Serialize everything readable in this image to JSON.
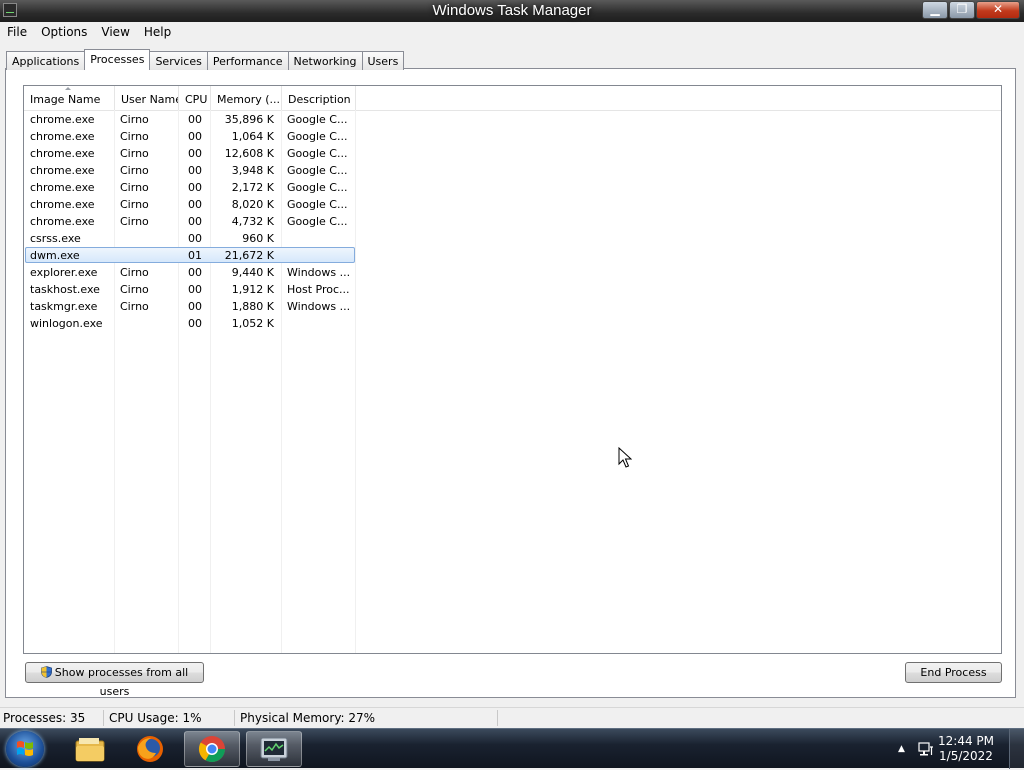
{
  "window": {
    "title": "Windows Task Manager",
    "minimize_glyph": "▁",
    "maximize_glyph": "❐",
    "close_glyph": "✕"
  },
  "menu": [
    "File",
    "Options",
    "View",
    "Help"
  ],
  "tabs": [
    "Applications",
    "Processes",
    "Services",
    "Performance",
    "Networking",
    "Users"
  ],
  "active_tab": "Processes",
  "columns": {
    "image_name": "Image Name",
    "user_name": "User Name",
    "cpu": "CPU",
    "memory": "Memory (...",
    "description": "Description"
  },
  "processes": [
    {
      "name": "chrome.exe",
      "user": "Cirno",
      "cpu": "00",
      "memory": "35,896 K",
      "description": "Google C..."
    },
    {
      "name": "chrome.exe",
      "user": "Cirno",
      "cpu": "00",
      "memory": "1,064 K",
      "description": "Google C..."
    },
    {
      "name": "chrome.exe",
      "user": "Cirno",
      "cpu": "00",
      "memory": "12,608 K",
      "description": "Google C..."
    },
    {
      "name": "chrome.exe",
      "user": "Cirno",
      "cpu": "00",
      "memory": "3,948 K",
      "description": "Google C..."
    },
    {
      "name": "chrome.exe",
      "user": "Cirno",
      "cpu": "00",
      "memory": "2,172 K",
      "description": "Google C..."
    },
    {
      "name": "chrome.exe",
      "user": "Cirno",
      "cpu": "00",
      "memory": "8,020 K",
      "description": "Google C..."
    },
    {
      "name": "chrome.exe",
      "user": "Cirno",
      "cpu": "00",
      "memory": "4,732 K",
      "description": "Google C..."
    },
    {
      "name": "csrss.exe",
      "user": "",
      "cpu": "00",
      "memory": "960 K",
      "description": ""
    },
    {
      "name": "dwm.exe",
      "user": "",
      "cpu": "01",
      "memory": "21,672 K",
      "description": "",
      "selected": true
    },
    {
      "name": "explorer.exe",
      "user": "Cirno",
      "cpu": "00",
      "memory": "9,440 K",
      "description": "Windows ..."
    },
    {
      "name": "taskhost.exe",
      "user": "Cirno",
      "cpu": "00",
      "memory": "1,912 K",
      "description": "Host Proc..."
    },
    {
      "name": "taskmgr.exe",
      "user": "Cirno",
      "cpu": "00",
      "memory": "1,880 K",
      "description": "Windows ..."
    },
    {
      "name": "winlogon.exe",
      "user": "",
      "cpu": "00",
      "memory": "1,052 K",
      "description": ""
    }
  ],
  "buttons": {
    "show_all": "Show processes from all users",
    "end_process": "End Process"
  },
  "status": {
    "processes": "Processes: 35",
    "cpu_usage": "CPU Usage: 1%",
    "physical_memory": "Physical Memory: 27%"
  },
  "taskbar": {
    "pinned": [
      "windows-explorer-icon",
      "firefox-icon",
      "chrome-icon",
      "task-manager-icon"
    ],
    "time": "12:44 PM",
    "date": "1/5/2022"
  },
  "colors": {
    "selection_fill": "#d6e8fb",
    "selection_border": "#84acdd",
    "taskbar": "#1a2230"
  }
}
